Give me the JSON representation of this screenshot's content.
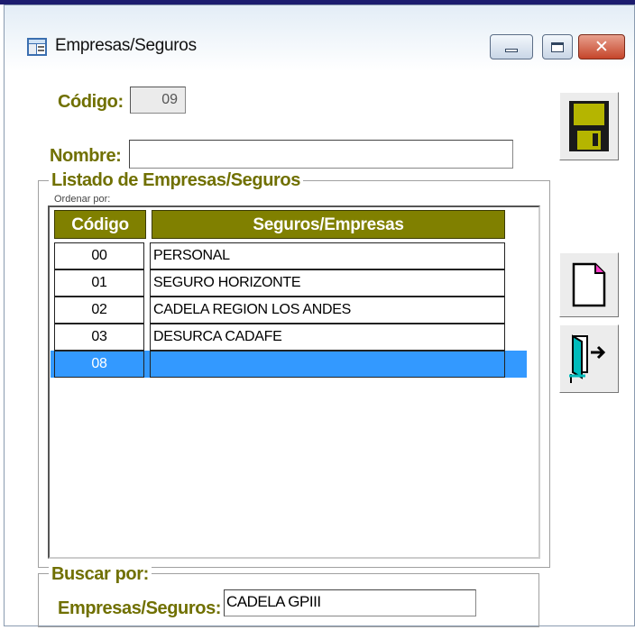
{
  "window": {
    "title": "Empresas/Seguros"
  },
  "form": {
    "codigo_label": "Código:",
    "codigo_value": "09",
    "nombre_label": "Nombre:",
    "nombre_value": ""
  },
  "listado": {
    "legend": "Listado de Empresas/Seguros",
    "ordenar_label": "Ordenar por:",
    "columns": [
      "Código",
      "Seguros/Empresas"
    ],
    "rows": [
      {
        "code": "00",
        "name": "PERSONAL"
      },
      {
        "code": "01",
        "name": "SEGURO HORIZONTE"
      },
      {
        "code": "02",
        "name": "CADELA REGION LOS ANDES"
      },
      {
        "code": "03",
        "name": "DESURCA CADAFE"
      },
      {
        "code": "08",
        "name": "",
        "selected": true
      }
    ]
  },
  "buscar": {
    "legend": "Buscar por:",
    "label": "Empresas/Seguros:",
    "value": "CADELA GPIII"
  },
  "icons": {
    "save": "floppy-disk-icon",
    "new": "new-document-icon",
    "exit": "exit-door-icon"
  },
  "colors": {
    "label_olive": "#707000",
    "header_olive": "#808000",
    "selection_blue": "#3399ff",
    "close_red": "#c5452a"
  }
}
